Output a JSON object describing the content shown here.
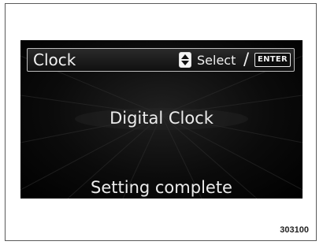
{
  "header": {
    "title": "Clock",
    "select_label": "Select",
    "separator": "/",
    "enter_label": "ENTER",
    "updown_icon": "up-down-arrows-icon"
  },
  "display": {
    "clock_type": "Digital Clock",
    "status": "Setting complete"
  },
  "figure": {
    "number": "303100"
  },
  "colors": {
    "screen_background": "#000000",
    "text": "#ececec",
    "page": "#ffffff"
  }
}
